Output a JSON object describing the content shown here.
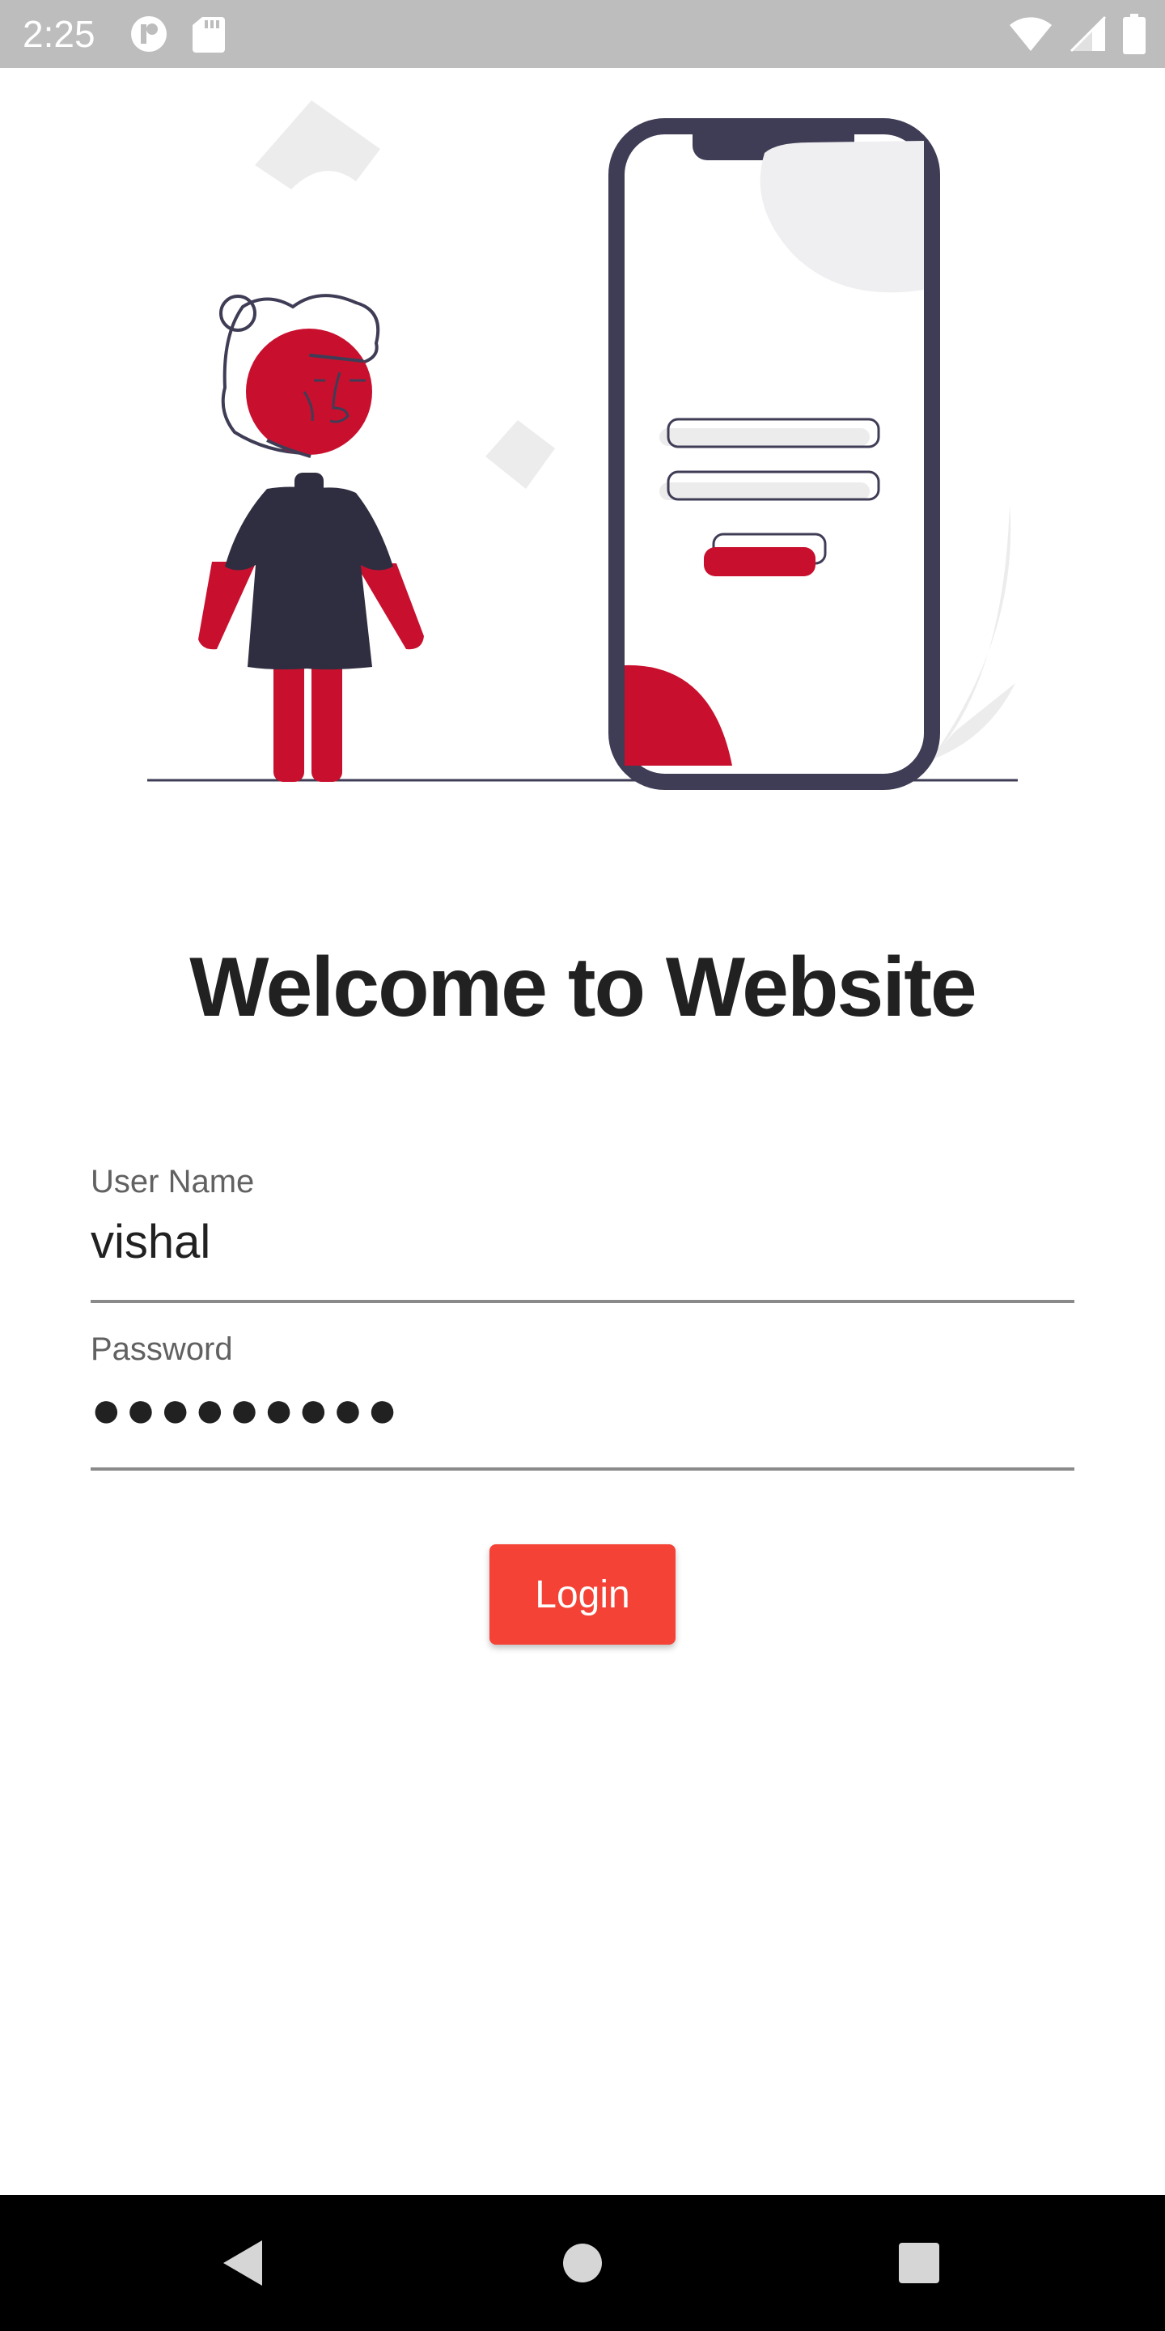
{
  "status_bar": {
    "time": "2:25",
    "background": "#bdbdbd",
    "icons_left": [
      "app-notification-icon",
      "sd-card-icon"
    ],
    "icons_right": [
      "wifi-icon",
      "cell-signal-icon",
      "battery-icon"
    ]
  },
  "illustration": {
    "description_icon": "login-illustration",
    "accent_color": "#c8102e",
    "dark_color": "#3f3d56"
  },
  "welcome": {
    "title": "Welcome to Website"
  },
  "form": {
    "username": {
      "label": "User Name",
      "value": "vishal"
    },
    "password": {
      "label": "Password",
      "masked_value": "●●●●●●●●●",
      "length": 9
    },
    "login_button": {
      "label": "Login",
      "color": "#f44336"
    }
  },
  "nav_bar": {
    "buttons": [
      "back-icon",
      "home-icon",
      "recents-icon"
    ]
  }
}
